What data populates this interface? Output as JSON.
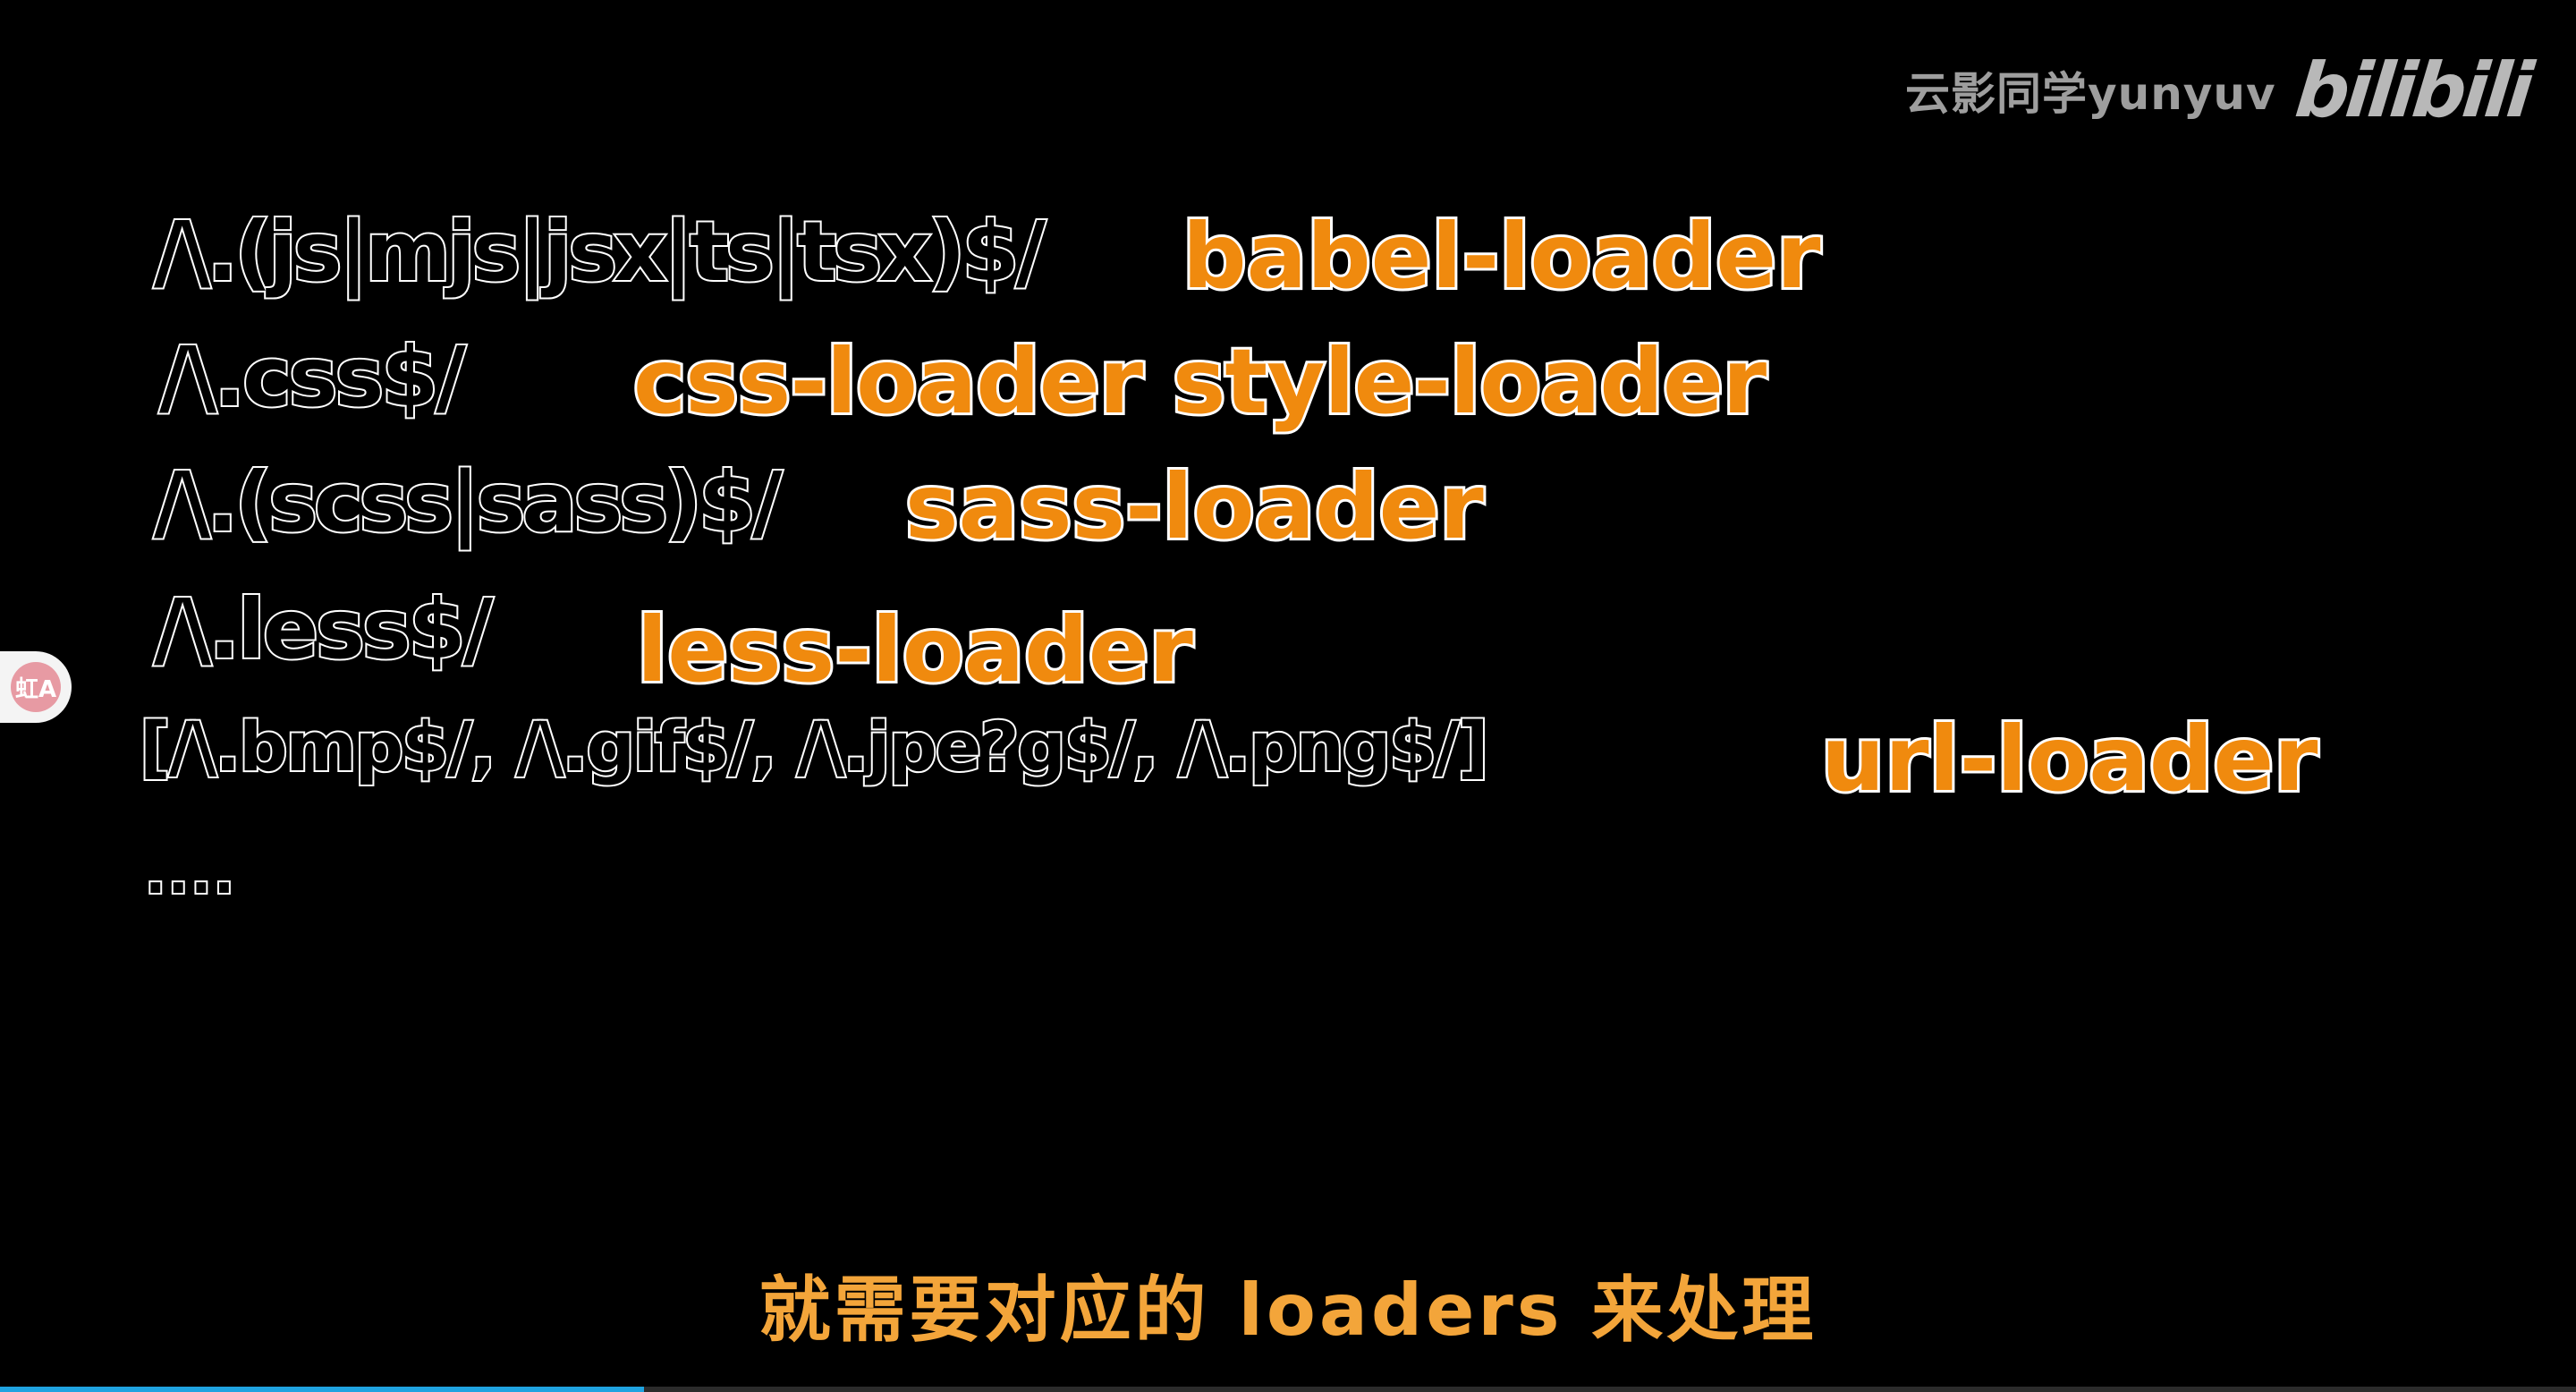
{
  "watermark": {
    "author": "云影同学yunyuv",
    "logo": "bilibili"
  },
  "rows": [
    {
      "pattern": "/\\.(js|mjs|jsx|ts|tsx)$/",
      "loader": "babel-loader"
    },
    {
      "pattern": "/\\.css$/",
      "loader": "css-loader style-loader"
    },
    {
      "pattern": "/\\.(scss|sass)$/",
      "loader": "sass-loader"
    },
    {
      "pattern": "/\\.less$/",
      "loader": "less-loader"
    },
    {
      "pattern": "[/\\.bmp$/, /\\.gif$/, /\\.jpe?g$/, /\\.png$/]",
      "loader": "url-loader"
    },
    {
      "pattern": "...."
    }
  ],
  "subtitle": "就需要对应的 loaders 来处理",
  "side_badge": {
    "icon": "translate-icon",
    "glyph": "虹A"
  },
  "progress": {
    "fraction": 0.25,
    "color": "#1fa3e0"
  },
  "colors": {
    "background": "#000000",
    "loader": "#f08a0e",
    "subtitle": "#f3a53a"
  }
}
